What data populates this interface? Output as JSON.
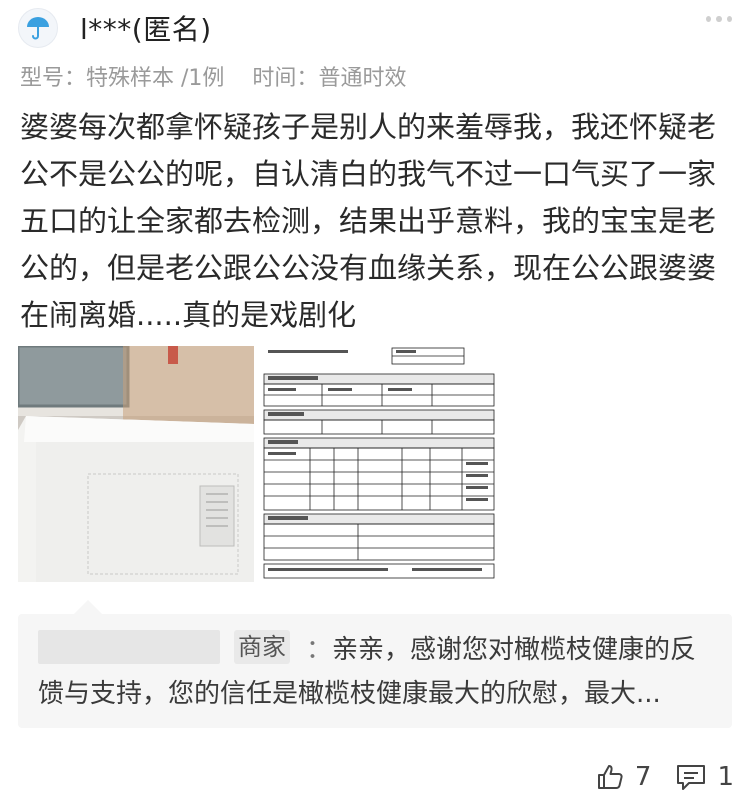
{
  "post": {
    "username": "l***(匿名)",
    "meta_model_label": "型号：",
    "meta_model_value": "特殊样本 /1例",
    "meta_time_label": "时间：",
    "meta_time_value": "普通时效",
    "review_text": "婆婆每次都拿怀疑孩子是别人的来羞辱我，我还怀疑老公不是公公的呢，自认清白的我气不过一口气买了一家五口的让全家都去检测，结果出乎意料，我的宝宝是老公的，但是老公跟公公没有血缘关系，现在公公跟婆婆在闹离婚.....真的是戏剧化"
  },
  "images": {
    "photo_1_name": "envelope-photo",
    "photo_2_name": "form-photo"
  },
  "reply": {
    "tag": "商家",
    "colon": "：",
    "text": "亲亲，感谢您对橄榄枝健康的反馈与支持，您的信任是橄榄枝健康最大的欣慰，最大..."
  },
  "actions": {
    "like_count": "7",
    "comment_count": "1"
  },
  "colors": {
    "meta": "#9a9a9a",
    "text": "#2a2a2a",
    "reply_bg": "#f6f6f6",
    "avatar_accent": "#3aa0e0"
  },
  "icons": [
    "umbrella-avatar-icon",
    "more-dots-icon",
    "thumbs-up-icon",
    "comment-icon"
  ]
}
